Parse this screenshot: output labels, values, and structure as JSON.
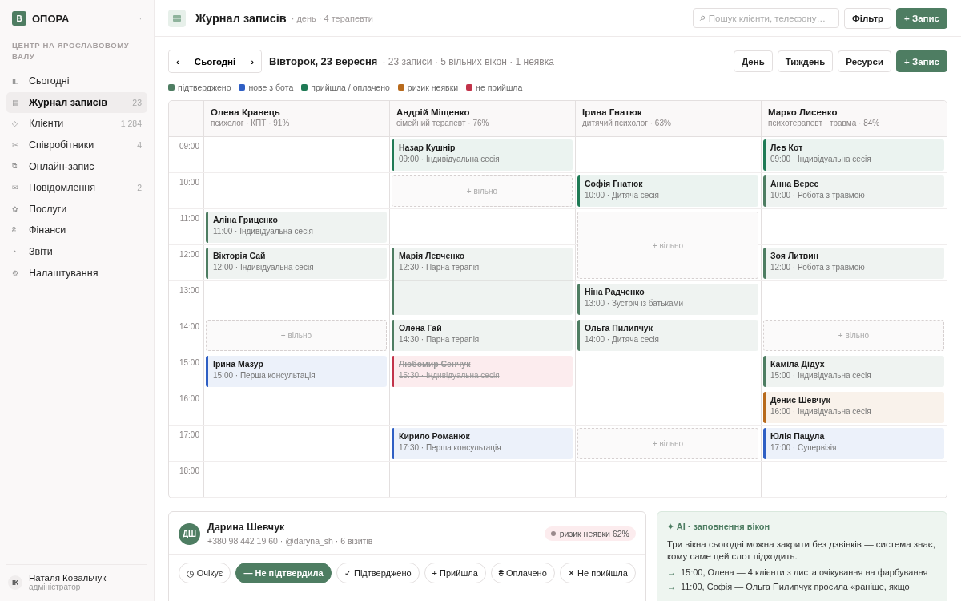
{
  "sidebar": {
    "logo": "В",
    "brand": "ОПОРА",
    "caret": "·",
    "section": "ЦЕНТР НА ЯРОСЛАВОВОМУ ВАЛУ",
    "items": [
      {
        "icon": "◧",
        "label": "Сьогодні",
        "selected": false
      },
      {
        "icon": "▤",
        "label": "Журнал записів",
        "count": "23",
        "selected": true
      },
      {
        "icon": "◇",
        "label": "Клієнти",
        "count": "1 284",
        "selected": false
      },
      {
        "icon": "✂",
        "label": "Співробітники",
        "count": "4",
        "selected": false
      },
      {
        "icon": "⧉",
        "label": "Онлайн-запис",
        "selected": false
      },
      {
        "icon": "✉",
        "label": "Повідомлення",
        "count": "2",
        "selected": false
      },
      {
        "icon": "✿",
        "label": "Послуги",
        "selected": false
      },
      {
        "icon": "₴",
        "label": "Фінанси",
        "selected": false
      },
      {
        "icon": "◔",
        "label": "Звіти",
        "selected": false
      },
      {
        "icon": "⚙",
        "label": "Налаштування",
        "selected": false
      }
    ],
    "user": {
      "initials": "ІК",
      "name": "Наталя Ковальчук",
      "role": "адміністратор"
    }
  },
  "header": {
    "title": "Журнал записів",
    "subtitle": "· день · 4 терапевти",
    "search_placeholder": "Пошук клієнти, телефону…",
    "filter": "Фільтр",
    "add": "+ Запис"
  },
  "toolbar": {
    "prev": "‹",
    "today": "Сьогодні",
    "next": "›",
    "date": "Вівторок, 23 вересня",
    "summary": "· 23 записи · 5 вільних вікон · 1 неявка",
    "views": [
      {
        "label": "День",
        "selected": false
      },
      {
        "label": "Тиждень",
        "selected": false
      },
      {
        "label": "Ресурси",
        "selected": false
      }
    ],
    "add": "+ Запис"
  },
  "legend": [
    {
      "label": "підтверджено",
      "color": "#4e7d62"
    },
    {
      "label": "нове з бота",
      "color": "#2f5fc4"
    },
    {
      "label": "прийшла / оплачено",
      "color": "#1f7a55"
    },
    {
      "label": "ризик неявки",
      "color": "#b86a1c"
    },
    {
      "label": "не прийшла",
      "color": "#c2334a"
    }
  ],
  "calendar": {
    "therapists": [
      {
        "name": "Олена Кравець",
        "info": "психолог · КПТ · 91%"
      },
      {
        "name": "Андрій Міщенко",
        "info": "сімейний терапевт · 76%"
      },
      {
        "name": "Ірина Гнатюк",
        "info": "дитячий психолог · 63%"
      },
      {
        "name": "Марко Лисенко",
        "info": "психотерапевт · травма · 84%"
      }
    ],
    "rows": [
      {
        "hour": "09:00",
        "slots": [
          {
            "kind": "empty"
          },
          {
            "kind": "appointment",
            "color": "#1f7a55",
            "no_show": false,
            "client": "Назар Кушнір",
            "detail": "09:00 · Індивідуальна сесія"
          },
          {
            "kind": "empty"
          },
          {
            "kind": "appointment",
            "color": "#1f7a55",
            "no_show": false,
            "client": "Лев Кот",
            "detail": "09:00 · Індивідуальна сесія"
          }
        ]
      },
      {
        "hour": "10:00",
        "slots": [
          {
            "kind": "empty"
          },
          {
            "kind": "free",
            "label": "+ вільно"
          },
          {
            "kind": "appointment",
            "color": "#1f7a55",
            "no_show": false,
            "client": "Софія Гнатюк",
            "detail": "10:00 · Дитяча сесія"
          },
          {
            "kind": "appointment",
            "color": "#4e7d62",
            "no_show": false,
            "client": "Анна Верес",
            "detail": "10:00 · Робота з травмою"
          }
        ]
      },
      {
        "hour": "11:00",
        "slots": [
          {
            "kind": "appointment",
            "color": "#4e7d62",
            "no_show": false,
            "client": "Аліна Гриценко",
            "detail": "11:00 · Індивідуальна сесія"
          },
          {
            "kind": "empty"
          },
          {
            "kind": "free",
            "label": "+ вільно"
          },
          {
            "kind": "empty"
          }
        ]
      },
      {
        "hour": "12:00",
        "slots": [
          {
            "kind": "appointment",
            "color": "#4e7d62",
            "no_show": false,
            "client": "Вікторія Сай",
            "detail": "12:00 · Індивідуальна сесія"
          },
          {
            "kind": "appointment",
            "color": "#4e7d62",
            "no_show": false,
            "client": "Марія Левченко",
            "detail": "12:30 · Парна терапія"
          },
          {
            "kind": "continued"
          },
          {
            "kind": "appointment",
            "color": "#4e7d62",
            "no_show": false,
            "client": "Зоя Литвин",
            "detail": "12:00 · Робота з травмою"
          }
        ]
      },
      {
        "hour": "13:00",
        "slots": [
          {
            "kind": "empty"
          },
          {
            "kind": "continued"
          },
          {
            "kind": "appointment",
            "color": "#4e7d62",
            "no_show": false,
            "client": "Ніна Радченко",
            "detail": "13:00 · Зустріч із батьками"
          },
          {
            "kind": "empty"
          }
        ]
      },
      {
        "hour": "14:00",
        "slots": [
          {
            "kind": "free",
            "label": "+ вільно"
          },
          {
            "kind": "appointment",
            "color": "#4e7d62",
            "no_show": false,
            "client": "Олена Гай",
            "detail": "14:30 · Парна терапія"
          },
          {
            "kind": "appointment",
            "color": "#4e7d62",
            "no_show": false,
            "client": "Ольга Пилипчук",
            "detail": "14:00 · Дитяча сесія"
          },
          {
            "kind": "free",
            "label": "+ вільно"
          }
        ]
      },
      {
        "hour": "15:00",
        "slots": [
          {
            "kind": "appointment",
            "color": "#2f5fc4",
            "no_show": false,
            "client": "Ірина Мазур",
            "detail": "15:00 · Перша консультація"
          },
          {
            "kind": "appointment",
            "color": "#c2334a",
            "no_show": true,
            "client": "Любомир Сенчук",
            "detail": "15:30 · Індивідуальна сесія"
          },
          {
            "kind": "empty"
          },
          {
            "kind": "appointment",
            "color": "#4e7d62",
            "no_show": false,
            "client": "Каміла Дідух",
            "detail": "15:00 · Індивідуальна сесія"
          }
        ]
      },
      {
        "hour": "16:00",
        "slots": [
          {
            "kind": "empty"
          },
          {
            "kind": "empty"
          },
          {
            "kind": "empty"
          },
          {
            "kind": "appointment",
            "color": "#b86a1c",
            "no_show": false,
            "client": "Денис Шевчук",
            "detail": "16:00 · Індивідуальна сесія"
          }
        ]
      },
      {
        "hour": "17:00",
        "slots": [
          {
            "kind": "empty"
          },
          {
            "kind": "appointment",
            "color": "#2f5fc4",
            "no_show": false,
            "client": "Кирило Романюк",
            "detail": "17:30 · Перша консультація"
          },
          {
            "kind": "free",
            "label": "+ вільно"
          },
          {
            "kind": "appointment",
            "color": "#2f5fc4",
            "no_show": false,
            "client": "Юлія Пацула",
            "detail": "17:00 · Супервізія"
          }
        ]
      },
      {
        "hour": "18:00",
        "slots": [
          {
            "kind": "empty"
          },
          {
            "kind": "empty"
          },
          {
            "kind": "empty"
          },
          {
            "kind": "empty"
          }
        ]
      }
    ]
  },
  "client_card": {
    "initials": "ДШ",
    "name": "Дарина Шевчук",
    "contacts": "+380 98 442 19 60 · @daryna_sh · 6 візитів",
    "risk": "ризик неявки 62%",
    "statuses": [
      {
        "label": "◷ Очікує",
        "selected": false
      },
      {
        "label": "— Не підтвердила",
        "selected": true
      },
      {
        "label": "✓ Підтверджено",
        "selected": false
      },
      {
        "label": "+ Прийшла",
        "selected": false
      },
      {
        "label": "₴ Оплачено",
        "selected": false
      },
      {
        "label": "✕ Не прийшла",
        "selected": false
      }
    ]
  },
  "ai_panel": {
    "title": "✦ AI · заповнення вікон",
    "text": "Три вікна сьогодні можна закрити без дзвінків — система знає, кому саме цей слот підходить.",
    "suggestions": [
      {
        "arrow": "→",
        "text": "15:00, Олена — 4 клієнти з листа очікування на фарбування"
      },
      {
        "arrow": "→",
        "text": "11:00, Софія — Ольга Пилипчук просила «раніше, якщо"
      }
    ]
  }
}
